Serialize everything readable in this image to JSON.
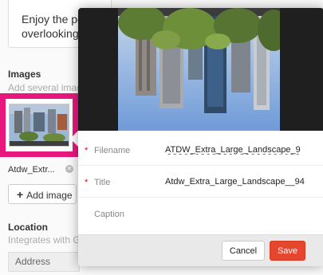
{
  "background": {
    "description_lines": [
      "Enjoy the pe",
      "overlooking"
    ],
    "images_label": "Images",
    "images_hint": "Add several image",
    "thumb_name": "Atdw_Extr...",
    "add_image_label": "Add image",
    "location_label": "Location",
    "location_hint": "Integrates with G",
    "address_label": "Address"
  },
  "modal": {
    "fields": [
      {
        "label": "Filename",
        "value": "ATDW_Extra_Large_Landscape_9",
        "required": true
      },
      {
        "label": "Title",
        "value": "Atdw_Extra_Large_Landscape__94",
        "required": true
      },
      {
        "label": "Caption",
        "value": "",
        "required": false
      }
    ],
    "required_marker": "*",
    "cancel_label": "Cancel",
    "save_label": "Save"
  },
  "colors": {
    "focus_pink": "#e8177e",
    "save_red": "#e5462d",
    "required_red": "#e0001b"
  },
  "icons": {
    "add": "plus-icon",
    "remove": "close-icon"
  }
}
